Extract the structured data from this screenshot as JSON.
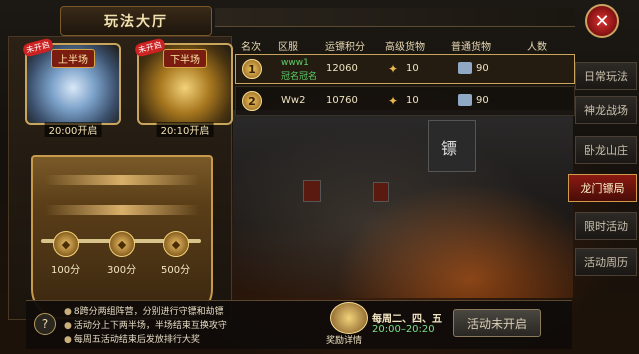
{
  "title": "玩法大厅",
  "close": "✕",
  "halves": [
    {
      "name": "上半场",
      "badge": "未开启",
      "time": "20:00开启"
    },
    {
      "name": "下半场",
      "badge": "未开启",
      "time": "20:10开启"
    }
  ],
  "progress": {
    "rewards": [
      "100分",
      "300分",
      "500分"
    ]
  },
  "table": {
    "headers": [
      "名次",
      "区服",
      "运镖积分",
      "高级货物",
      "普通货物",
      "人数"
    ],
    "rows": [
      {
        "rank": "1",
        "server": "www1",
        "server_sub": "冠名冠名",
        "score": "12060",
        "advanced": "10",
        "normal": "90"
      },
      {
        "rank": "2",
        "server": "Ww2",
        "server_sub": "",
        "score": "10760",
        "advanced": "10",
        "normal": "90"
      }
    ]
  },
  "tabs": [
    {
      "label": "日常玩法"
    },
    {
      "label": "神龙战场"
    },
    {
      "label": "卧龙山庄"
    },
    {
      "label": "龙门镖局",
      "active": true
    },
    {
      "label": "限时活动"
    },
    {
      "label": "活动周历"
    }
  ],
  "rules": [
    "8跨分两组阵营，分别进行守镖和劫镖",
    "活动分上下两半场，半场结束互换攻守",
    "每周五活动结束后发放排行大奖"
  ],
  "reward_details": "奖励详情",
  "schedule": {
    "days": "每周二、四、五",
    "time": "20:00–20:20"
  },
  "start_button": "活动未开启",
  "help": "?",
  "flag_char": "镖"
}
